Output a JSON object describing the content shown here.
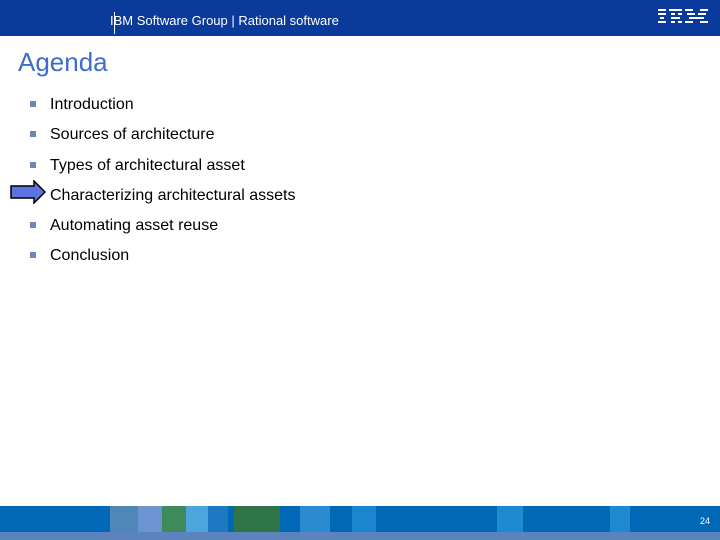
{
  "header": {
    "title": "IBM Software Group | Rational software",
    "logo_text": "IBM"
  },
  "main": {
    "title": "Agenda",
    "items": [
      {
        "label": "Introduction",
        "current": false
      },
      {
        "label": "Sources of architecture",
        "current": false
      },
      {
        "label": "Types of architectural asset",
        "current": false
      },
      {
        "label": "Characterizing architectural assets",
        "current": true
      },
      {
        "label": "Automating asset reuse",
        "current": false
      },
      {
        "label": "Conclusion",
        "current": false
      }
    ],
    "indicator_icon": "arrow-right-icon"
  },
  "footer": {
    "page_number": "24"
  },
  "colors": {
    "header_background": "#0a3a9c",
    "title_color": "#3c6ec9",
    "bullet_color": "#6a88b8",
    "arrow_fill": "#5b74e0"
  }
}
